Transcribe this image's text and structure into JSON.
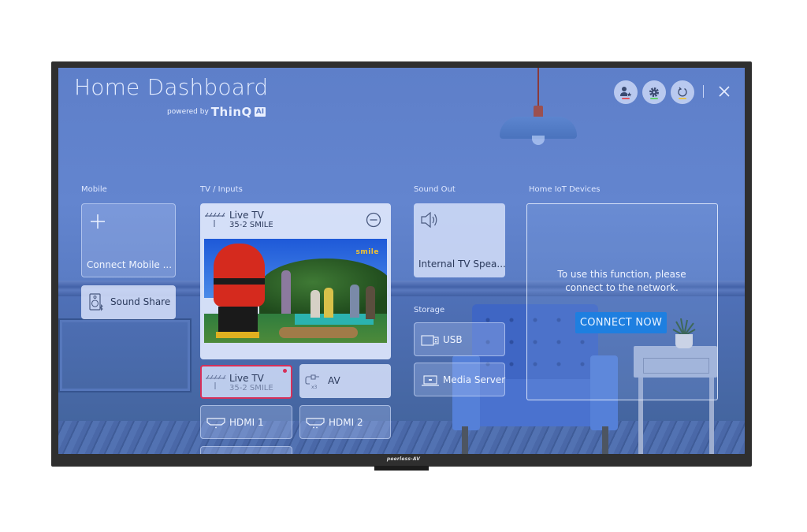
{
  "header": {
    "title": "Home Dashboard",
    "powered_by": "powered by",
    "thinq": "ThinQ",
    "ai_badge": "AI",
    "buttons": [
      {
        "name": "user-profile",
        "icon": "person-star-icon",
        "indicator_color": "#e0545f"
      },
      {
        "name": "settings",
        "icon": "gear-icon",
        "indicator_color": "#5fcf6c"
      },
      {
        "name": "refresh",
        "icon": "refresh-icon",
        "indicator_color": "#e6c24a"
      }
    ],
    "close_icon": "close-icon"
  },
  "sections": {
    "mobile": {
      "label": "Mobile",
      "connect_mobile": "Connect Mobile ...",
      "sound_share": "Sound Share"
    },
    "tv_inputs": {
      "label": "TV / Inputs",
      "current": {
        "title": "Live TV",
        "channel": "35-2 SMILE"
      },
      "video_channel_logo": "smile",
      "inputs": [
        {
          "label": "Live TV",
          "sub": "35-2 SMILE",
          "selected": true,
          "icon": "antenna-icon"
        },
        {
          "label": "AV",
          "icon": "av-cable-icon",
          "badge": "x3"
        },
        {
          "label": "HDMI 1",
          "icon": "hdmi-icon"
        },
        {
          "label": "HDMI 2",
          "icon": "hdmi-icon"
        }
      ]
    },
    "sound_out": {
      "label": "Sound Out",
      "device": "Internal TV Spea..."
    },
    "storage": {
      "label": "Storage",
      "items": [
        {
          "label": "USB",
          "icon": "usb-icon"
        },
        {
          "label": "Media Server",
          "icon": "laptop-icon"
        }
      ]
    },
    "iot": {
      "label": "Home IoT Devices",
      "message_line1": "To use this function, please",
      "message_line2": "connect to the network.",
      "connect_button": "CONNECT NOW"
    }
  },
  "bezel_brand": "peerless-AV",
  "colors": {
    "accent": "#1e7fe0",
    "selected_border": "#d6305a",
    "bezel": "#2f2f2f"
  }
}
